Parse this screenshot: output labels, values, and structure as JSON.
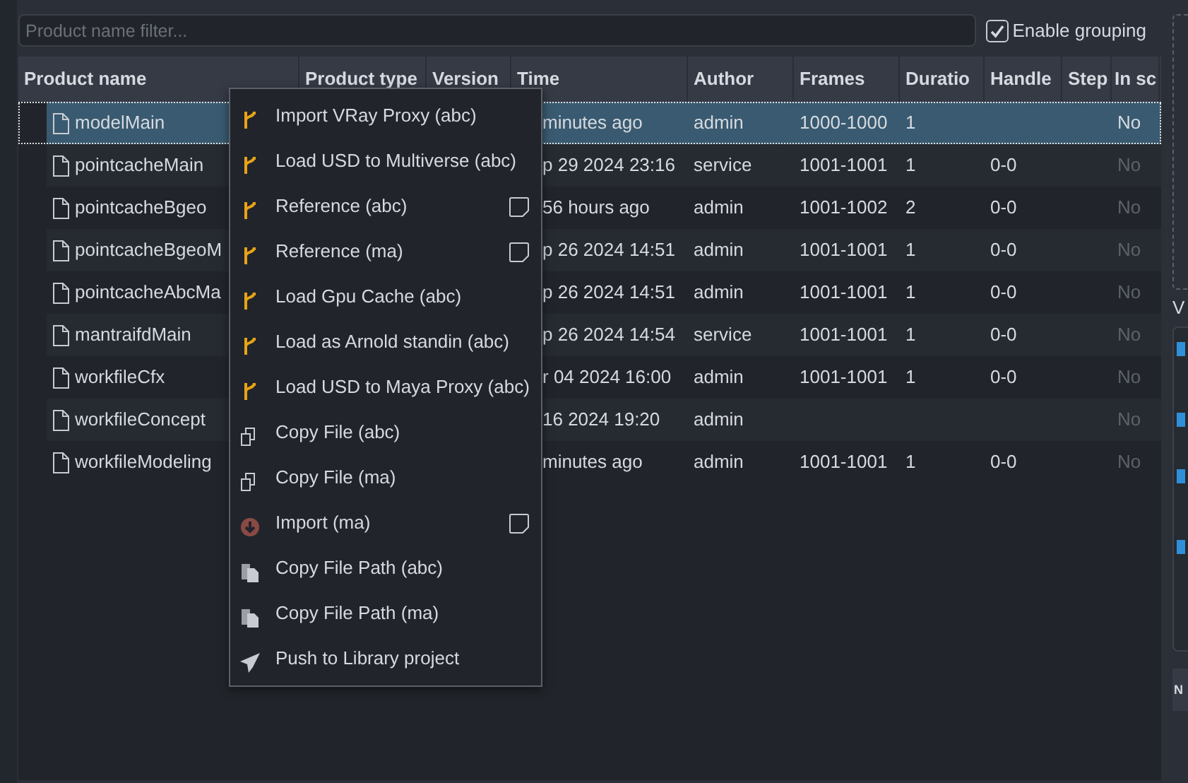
{
  "filter": {
    "placeholder": "Product name filter..."
  },
  "grouping": {
    "label": "Enable grouping",
    "checked": true
  },
  "table": {
    "columns": [
      "Product name",
      "Product type",
      "Version",
      "Time",
      "Author",
      "Frames",
      "Duratio",
      "Handle",
      "Step",
      "In sc"
    ],
    "rows": [
      {
        "name": "modelMain",
        "time": "minutes ago",
        "author": "admin",
        "frames": "1000-1000",
        "duration": "1",
        "in_scene": "No",
        "selected": true
      },
      {
        "name": "pointcacheMain",
        "time": "p 29 2024 23:16",
        "author": "service",
        "frames": "1001-1001",
        "duration": "1",
        "handles": "0-0",
        "in_scene": "No",
        "selected": false
      },
      {
        "name": "pointcacheBgeo",
        "time": "56 hours ago",
        "author": "admin",
        "frames": "1001-1002",
        "duration": "2",
        "handles": "0-0",
        "in_scene": "No",
        "selected": false
      },
      {
        "name": "pointcacheBgeoM",
        "time": "p 26 2024 14:51",
        "author": "admin",
        "frames": "1001-1001",
        "duration": "1",
        "handles": "0-0",
        "in_scene": "No",
        "selected": false
      },
      {
        "name": "pointcacheAbcMa",
        "time": "p 26 2024 14:51",
        "author": "admin",
        "frames": "1001-1001",
        "duration": "1",
        "handles": "0-0",
        "in_scene": "No",
        "selected": false
      },
      {
        "name": "mantraifdMain",
        "time": "p 26 2024 14:54",
        "author": "service",
        "frames": "1001-1001",
        "duration": "1",
        "handles": "0-0",
        "in_scene": "No",
        "selected": false
      },
      {
        "name": "workfileCfx",
        "time": "r 04 2024 16:00",
        "author": "admin",
        "frames": "1001-1001",
        "duration": "1",
        "handles": "0-0",
        "in_scene": "No",
        "selected": false
      },
      {
        "name": "workfileConcept",
        "time": "16 2024 19:20",
        "author": "admin",
        "in_scene": "No",
        "selected": false
      },
      {
        "name": "workfileModeling",
        "time": "minutes ago",
        "author": "admin",
        "frames": "1001-1001",
        "duration": "1",
        "handles": "0-0",
        "in_scene": "No",
        "selected": false
      }
    ]
  },
  "context_menu": {
    "items": [
      {
        "label": "Import VRay Proxy (abc)",
        "kind": "loader",
        "has_options": false
      },
      {
        "label": "Load USD to Multiverse (abc)",
        "kind": "loader",
        "has_options": false
      },
      {
        "label": "Reference (abc)",
        "kind": "loader",
        "has_options": true
      },
      {
        "label": "Reference (ma)",
        "kind": "loader",
        "has_options": true
      },
      {
        "label": "Load Gpu Cache (abc)",
        "kind": "loader",
        "has_options": false
      },
      {
        "label": "Load as Arnold standin (abc)",
        "kind": "loader",
        "has_options": false
      },
      {
        "label": "Load USD to Maya Proxy (abc)",
        "kind": "loader",
        "has_options": false
      },
      {
        "label": "Copy File (abc)",
        "kind": "copy",
        "has_options": false
      },
      {
        "label": "Copy File (ma)",
        "kind": "copy",
        "has_options": false
      },
      {
        "label": "Import (ma)",
        "kind": "import",
        "has_options": true
      },
      {
        "label": "Copy File Path (abc)",
        "kind": "path",
        "has_options": false
      },
      {
        "label": "Copy File Path (ma)",
        "kind": "path",
        "has_options": false
      },
      {
        "label": "Push to Library project",
        "kind": "push",
        "has_options": false
      }
    ]
  },
  "side_panel": {
    "label": "V",
    "header": "N"
  }
}
